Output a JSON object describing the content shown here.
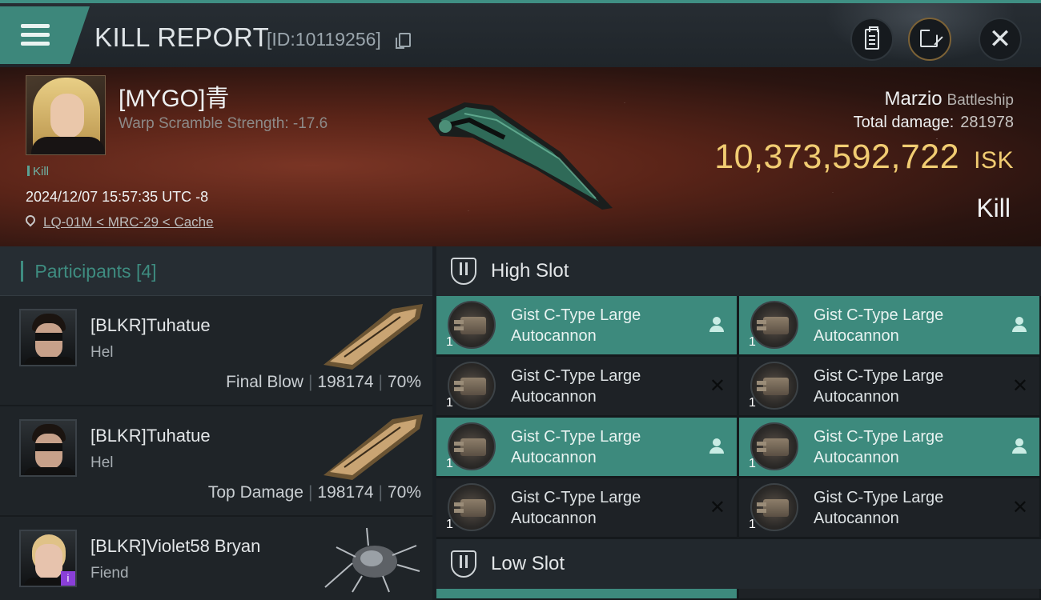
{
  "header": {
    "title": "KILL REPORT",
    "report_id": "[ID:10119256]"
  },
  "victim": {
    "name": "[MYGO]青",
    "warp_scramble": "Warp Scramble Strength: -17.6",
    "tag": "Kill",
    "datetime": "2024/12/07 15:57:35 UTC -8",
    "location": "LQ-01M < MRC-29 < Cache",
    "ship_name": "Marzio",
    "ship_class": "Battleship",
    "total_damage_label": "Total damage:",
    "total_damage": "281978",
    "isk_value": "10,373,592,722",
    "isk_unit": "ISK",
    "result": "Kill"
  },
  "participants": {
    "label": "Participants",
    "count": "[4]",
    "items": [
      {
        "name": "[BLKR]Tuhatue",
        "ship": "Hel",
        "role": "Final Blow",
        "damage": "198174",
        "percent": "70%"
      },
      {
        "name": "[BLKR]Tuhatue",
        "ship": "Hel",
        "role": "Top Damage",
        "damage": "198174",
        "percent": "70%"
      },
      {
        "name": "[BLKR]Violet58 Bryan",
        "ship": "Fiend",
        "badge": "i"
      }
    ]
  },
  "slots": {
    "high_slot_label": "High Slot",
    "low_slot_label": "Low Slot",
    "modules": [
      {
        "name": "Gist C-Type Large Autocannon",
        "qty": "1",
        "status": "dropped"
      },
      {
        "name": "Gist C-Type Large Autocannon",
        "qty": "1",
        "status": "dropped"
      },
      {
        "name": "Gist C-Type Large Autocannon",
        "qty": "1",
        "status": "destroyed"
      },
      {
        "name": "Gist C-Type Large Autocannon",
        "qty": "1",
        "status": "destroyed"
      },
      {
        "name": "Gist C-Type Large Autocannon",
        "qty": "1",
        "status": "dropped"
      },
      {
        "name": "Gist C-Type Large Autocannon",
        "qty": "1",
        "status": "dropped"
      },
      {
        "name": "Gist C-Type Large Autocannon",
        "qty": "1",
        "status": "destroyed"
      },
      {
        "name": "Gist C-Type Large Autocannon",
        "qty": "1",
        "status": "destroyed"
      }
    ]
  },
  "colors": {
    "accent": "#3d8a7d",
    "isk": "#f1cc72",
    "banner": "#5a2418"
  }
}
